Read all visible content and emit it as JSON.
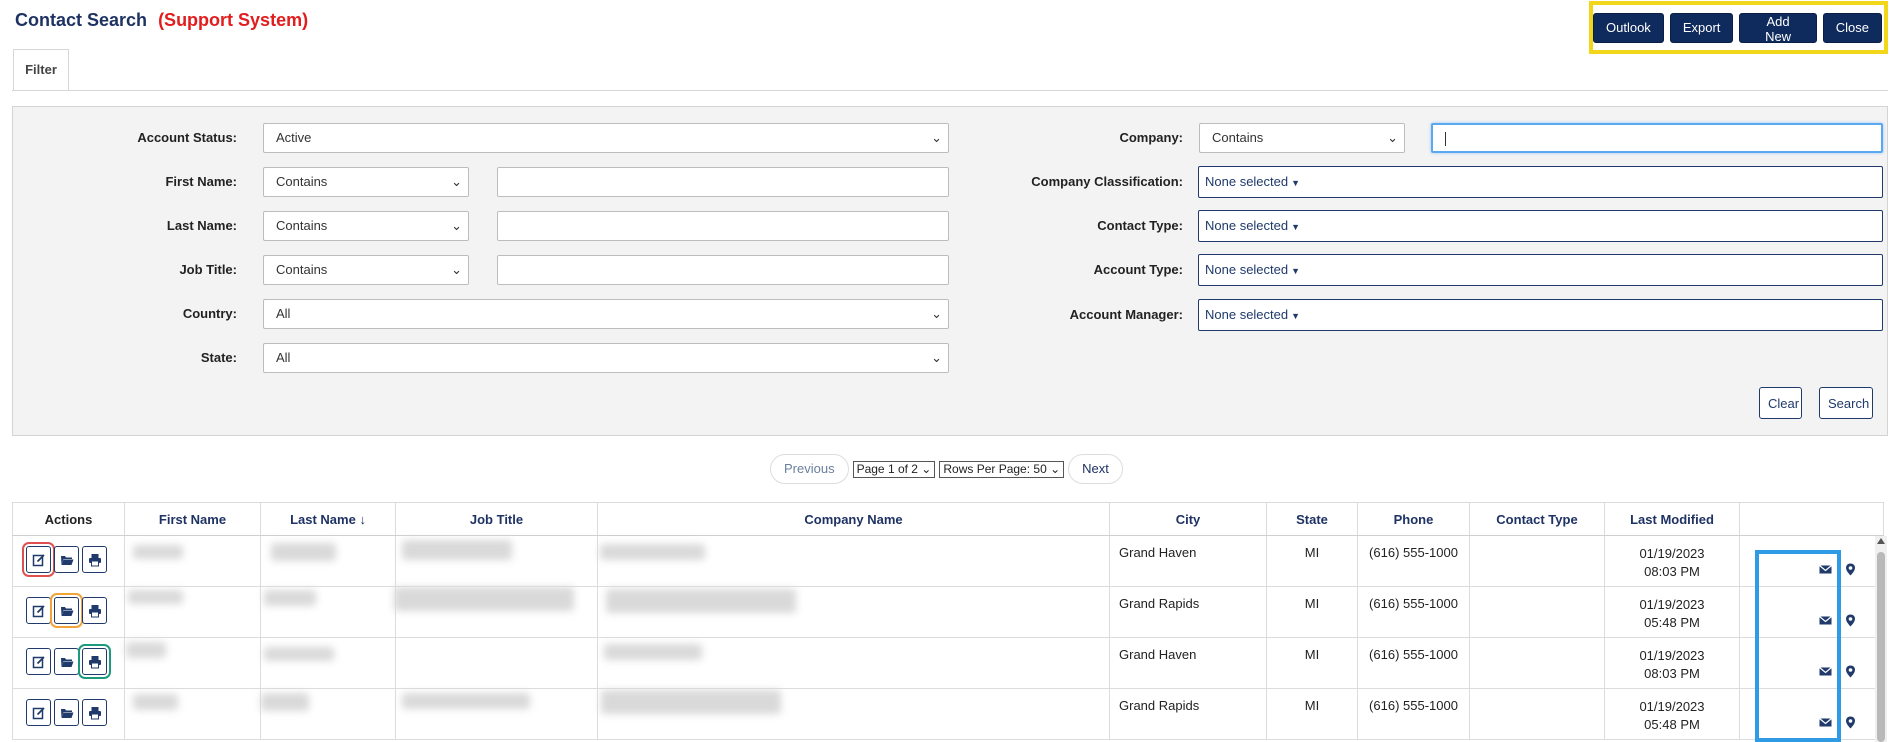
{
  "header": {
    "title": "Contact Search",
    "subtitle": "(Support System)"
  },
  "top_buttons": {
    "outlook": "Outlook",
    "export": "Export",
    "add_new": "Add New",
    "close": "Close"
  },
  "tabs": [
    {
      "label": "Filter"
    }
  ],
  "filter": {
    "account_status": {
      "label": "Account Status:",
      "value": "Active"
    },
    "first_name": {
      "label": "First Name:",
      "operator": "Contains",
      "value": ""
    },
    "last_name": {
      "label": "Last Name:",
      "operator": "Contains",
      "value": ""
    },
    "job_title": {
      "label": "Job Title:",
      "operator": "Contains",
      "value": ""
    },
    "country": {
      "label": "Country:",
      "value": "All"
    },
    "state": {
      "label": "State:",
      "value": "All"
    },
    "company": {
      "label": "Company:",
      "operator": "Contains",
      "value": ""
    },
    "company_classification": {
      "label": "Company Classification:",
      "value": "None selected"
    },
    "contact_type": {
      "label": "Contact Type:",
      "value": "None selected"
    },
    "account_type": {
      "label": "Account Type:",
      "value": "None selected"
    },
    "account_manager": {
      "label": "Account Manager:",
      "value": "None selected"
    },
    "clear_label": "Clear",
    "search_label": "Search"
  },
  "pager": {
    "previous": "Previous",
    "page": "Page 1 of 2",
    "rows_per_page": "Rows Per Page: 50",
    "next": "Next"
  },
  "table": {
    "headers": {
      "actions": "Actions",
      "first_name": "First Name",
      "last_name": "Last Name",
      "job_title": "Job Title",
      "company_name": "Company Name",
      "city": "City",
      "state": "State",
      "phone": "Phone",
      "contact_type": "Contact Type",
      "last_modified": "Last Modified"
    },
    "sort_icon": "sort-ascending-icon",
    "rows": [
      {
        "city": "Grand Haven",
        "state": "MI",
        "phone": "(616) 555-1000",
        "contact_type": "",
        "date": "01/19/2023",
        "time": "08:03 PM"
      },
      {
        "city": "Grand Rapids",
        "state": "MI",
        "phone": "(616) 555-1000",
        "contact_type": "",
        "date": "01/19/2023",
        "time": "05:48 PM"
      },
      {
        "city": "Grand Haven",
        "state": "MI",
        "phone": "(616) 555-1000",
        "contact_type": "",
        "date": "01/19/2023",
        "time": "08:03 PM"
      },
      {
        "city": "Grand Rapids",
        "state": "MI",
        "phone": "(616) 555-1000",
        "contact_type": "",
        "date": "01/19/2023",
        "time": "05:48 PM"
      }
    ]
  },
  "icons": {
    "edit": "edit-icon",
    "folder": "folder-open-icon",
    "print": "print-icon",
    "email": "envelope-icon",
    "location": "map-pin-icon"
  },
  "colors": {
    "navy": "#0f2a5c",
    "title_red": "#e11d1d",
    "highlight_yellow": "#f1d61a",
    "highlight_blue": "#2f9be5"
  }
}
